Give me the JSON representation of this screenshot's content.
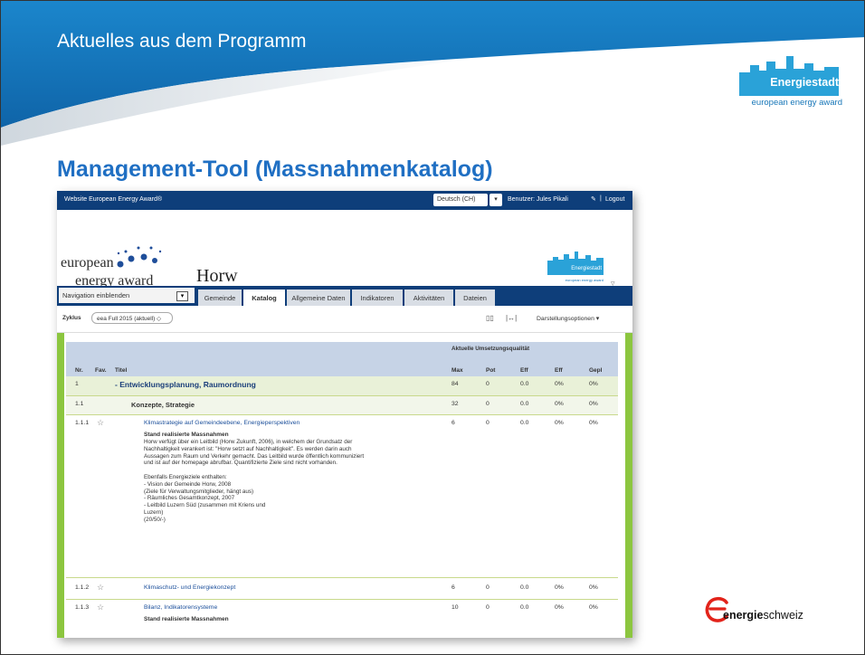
{
  "slide": {
    "header_title": "Aktuelles aus dem Programm",
    "heading": "Management-Tool (Massnahmenkatalog)",
    "logo_word": "Energiestadt",
    "logo_sub": "european energy award",
    "footer_logo_bold": "energie",
    "footer_logo_rest": "schweiz"
  },
  "colors": {
    "header_blue": "#1a7cc2",
    "heading_blue": "#1f6fc3",
    "nav_blue": "#0e3e7a",
    "green": "#8cc63f"
  },
  "app": {
    "site_title": "Website European Energy Award®",
    "language": "Deutsch (CH)",
    "language_arrow": "▾",
    "user": "Benutzer: Jules Pikali",
    "pencil": "✎",
    "separator": "|",
    "logout": "Logout",
    "eea1": "european",
    "eea2": "energy award",
    "town": "Horw",
    "mini_logo": "Energiestadt",
    "mini_logo_sub": "european energy award",
    "scroll": "▿",
    "nav_select": "Navigation einblenden",
    "nav_select_btn": "▾",
    "tabs": [
      "Gemeinde",
      "Katalog",
      "Allgemeine Daten",
      "Indikatoren",
      "Aktivitäten",
      "Dateien"
    ],
    "zyklus_label": "Zyklus",
    "zyklus_value": "eea Full 2015 (aktuell) ◇",
    "tb_icon1": "▯▯",
    "tb_icon2": "|↔|",
    "options": "Darstellungsoptionen ▾"
  },
  "table": {
    "group_header": "Aktuelle Umsetzungsqualität",
    "columns": [
      "Nr.",
      "Fav.",
      "Titel",
      "Max",
      "Pot",
      "Eff",
      "Eff",
      "Gepl"
    ],
    "rows": [
      {
        "nr": "1",
        "fav": "",
        "title": "- Entwicklungsplanung, Raumordnung",
        "max": "84",
        "pot": "0",
        "eff": "0.0",
        "effp": "0%",
        "gepl": "0%"
      },
      {
        "nr": "1.1",
        "fav": "",
        "title": "Konzepte, Strategie",
        "max": "32",
        "pot": "0",
        "eff": "0.0",
        "effp": "0%",
        "gepl": "0%"
      },
      {
        "nr": "1.1.1",
        "fav": "☆",
        "title": "Klimastrategie auf Gemeindeebene, Energieperspektiven",
        "max": "6",
        "pot": "0",
        "eff": "0.0",
        "effp": "0%",
        "gepl": "0%",
        "desc_title": "Stand realisierte Massnahmen",
        "desc": "Horw verfügt über ein Leitbild (Horw Zukunft, 2006), in welchem der Grundsatz der\nNachhaltigkeit verankert ist: \"Horw setzt auf Nachhaltigkeit\". Es werden darin auch\nAussagen zum Raum und Verkehr gemacht. Das Leitbild wurde öffentlich kommuniziert\nund ist auf der homepage abrufbar. Quantifizierte Ziele sind nicht vorhanden.\n\nEbenfalls Energieziele enthalten:\n- Vision der Gemeinde Horw, 2008\n  (Ziele für Verwaltungsmitglieder, hängt aus)\n- Räumliches Gesamtkonzept, 2007\n- Leitbild Luzern Süd (zusammen mit Kriens und\n  Luzern)\n(20/50/-)"
      },
      {
        "nr": "1.1.2",
        "fav": "☆",
        "title": "Klimaschutz- und Energiekonzept",
        "max": "6",
        "pot": "0",
        "eff": "0.0",
        "effp": "0%",
        "gepl": "0%"
      },
      {
        "nr": "1.1.3",
        "fav": "☆",
        "title": "Bilanz, Indikatorensysteme",
        "max": "10",
        "pot": "0",
        "eff": "0.0",
        "effp": "0%",
        "gepl": "0%",
        "desc_title": "Stand realisierte Massnahmen"
      }
    ]
  }
}
